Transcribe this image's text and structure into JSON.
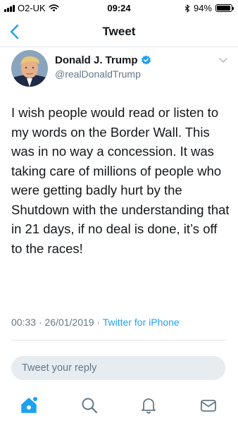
{
  "status_bar": {
    "carrier": "O2-UK",
    "time": "09:24",
    "battery_percent": "94%",
    "battery_level": 0.94,
    "icons": [
      "signal-icon",
      "wifi-icon",
      "bluetooth-icon",
      "battery-icon"
    ]
  },
  "nav": {
    "title": "Tweet",
    "back_icon": "chevron-left-icon"
  },
  "author": {
    "name": "Donald J. Trump",
    "handle": "@realDonaldTrump",
    "verified": true,
    "verified_icon": "verified-badge-icon"
  },
  "tweet": {
    "text": "I wish people would read or listen to my words on the Border Wall. This was in no way a concession. It was taking care of millions of people who were getting badly hurt by the Shutdown with the understanding that in 21 days, if no deal is done, it’s off to the races!",
    "time": "00:33",
    "date": "26/01/2019",
    "separator": "·",
    "source": "Twitter for iPhone"
  },
  "reply": {
    "placeholder": "Tweet your reply"
  },
  "tab_bar": {
    "tabs": [
      "home-icon",
      "search-icon",
      "notifications-icon",
      "messages-icon"
    ],
    "active": "home-icon"
  },
  "colors": {
    "accent": "#1da1f2",
    "text": "#14171a",
    "muted": "#657786",
    "border": "#e1e8ed"
  }
}
